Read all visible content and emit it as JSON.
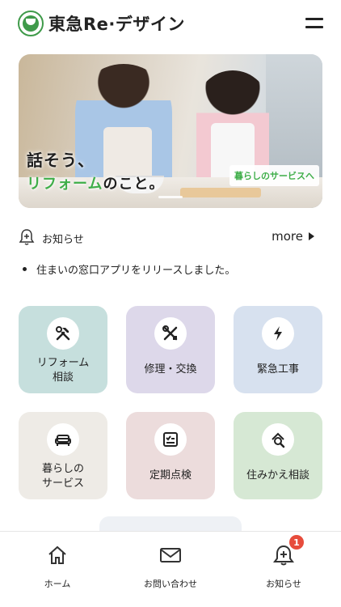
{
  "header": {
    "brand": "東急Re·デザイン"
  },
  "hero": {
    "headline_line1": "話そう、",
    "headline_line2_accent": "リフォーム",
    "headline_line2_rest": "のこと。",
    "badge": "暮らしのサービスへ"
  },
  "news": {
    "title": "お知らせ",
    "more_label": "more",
    "items": [
      {
        "text": "住まいの窓口アプリをリリースしました。"
      }
    ]
  },
  "services": [
    {
      "label_line1": "リフォーム",
      "label_line2": "相談",
      "icon": "tools-icon",
      "color": "#c6dfdd"
    },
    {
      "label_line1": "修理・交換",
      "label_line2": "",
      "icon": "wrench-screwdriver-icon",
      "color": "#ddd8ea"
    },
    {
      "label_line1": "緊急工事",
      "label_line2": "",
      "icon": "lightning-icon",
      "color": "#d7e1ef"
    },
    {
      "label_line1": "暮らしの",
      "label_line2": "サービス",
      "icon": "sofa-icon",
      "color": "#eeebe6"
    },
    {
      "label_line1": "定期点検",
      "label_line2": "",
      "icon": "checklist-icon",
      "color": "#ecdcdc"
    },
    {
      "label_line1": "住みかえ相談",
      "label_line2": "",
      "icon": "house-search-icon",
      "color": "#d6e8d4"
    }
  ],
  "bottom_nav": {
    "home": "ホーム",
    "contact": "お問い合わせ",
    "notice": "お知らせ",
    "notice_badge": "1"
  },
  "colors": {
    "brand_green": "#3fae49",
    "badge_red": "#e74c3c"
  }
}
